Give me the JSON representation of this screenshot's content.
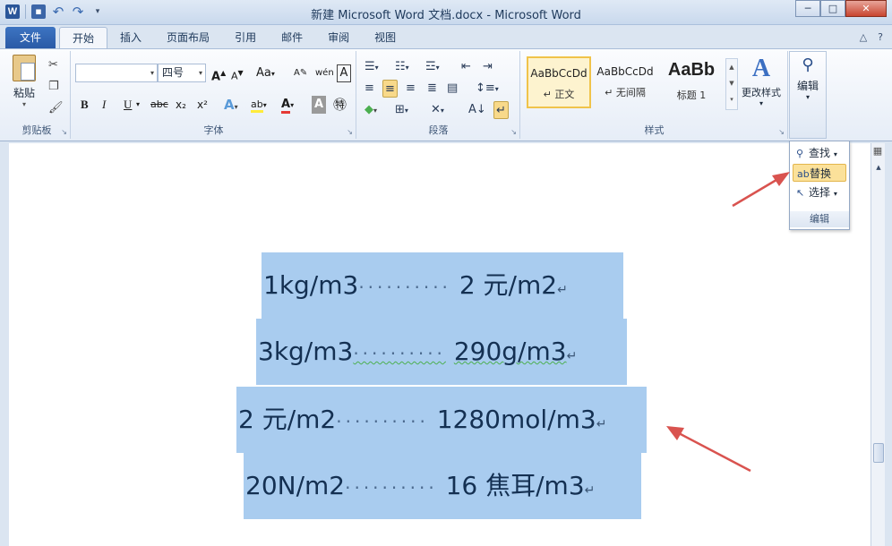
{
  "window": {
    "title": "新建 Microsoft Word 文档.docx - Microsoft Word",
    "minimize": "─",
    "maximize": "□",
    "close": "✕"
  },
  "quick_access": {
    "word_logo": "W",
    "icons": [
      "save-icon",
      "undo-icon",
      "redo-icon"
    ]
  },
  "tabs": [
    "文件",
    "开始",
    "插入",
    "页面布局",
    "引用",
    "邮件",
    "审阅",
    "视图"
  ],
  "ribbon": {
    "clipboard": {
      "paste": "粘贴",
      "label": "剪贴板"
    },
    "font": {
      "font_name": "",
      "font_size": "四号",
      "grow": "A",
      "shrink": "A",
      "case": "Aa",
      "bold": "B",
      "italic": "I",
      "underline": "U",
      "strike": "abc",
      "subscript": "x₂",
      "superscript": "x²",
      "label": "字体"
    },
    "paragraph": {
      "label": "段落"
    },
    "styles": {
      "items": [
        {
          "sample": "AaBbCcDd",
          "name": "↵ 正文"
        },
        {
          "sample": "AaBbCcDd",
          "name": "↵ 无间隔"
        },
        {
          "sample": "AaBb",
          "name": "标题 1"
        }
      ],
      "change": "更改样式",
      "label": "样式"
    },
    "editing": {
      "label": "编辑"
    }
  },
  "editing_dropdown": {
    "items": [
      "查找",
      "替换",
      "选择"
    ],
    "label": "编辑"
  },
  "document": {
    "lines": [
      {
        "left": "1kg/m3",
        "right": "2 元/m2"
      },
      {
        "left": "3kg/m3",
        "right": "290g/m3"
      },
      {
        "left": "2 元/m2",
        "right": "1280mol/m3"
      },
      {
        "left": "20N/m2",
        "right": "16 焦耳/m3"
      }
    ],
    "dots": "··········",
    "para_mark": "↵"
  },
  "colors": {
    "selection": "#a9ccef",
    "arrow": "#d9534f",
    "file_tab": "#2a5aa6"
  }
}
